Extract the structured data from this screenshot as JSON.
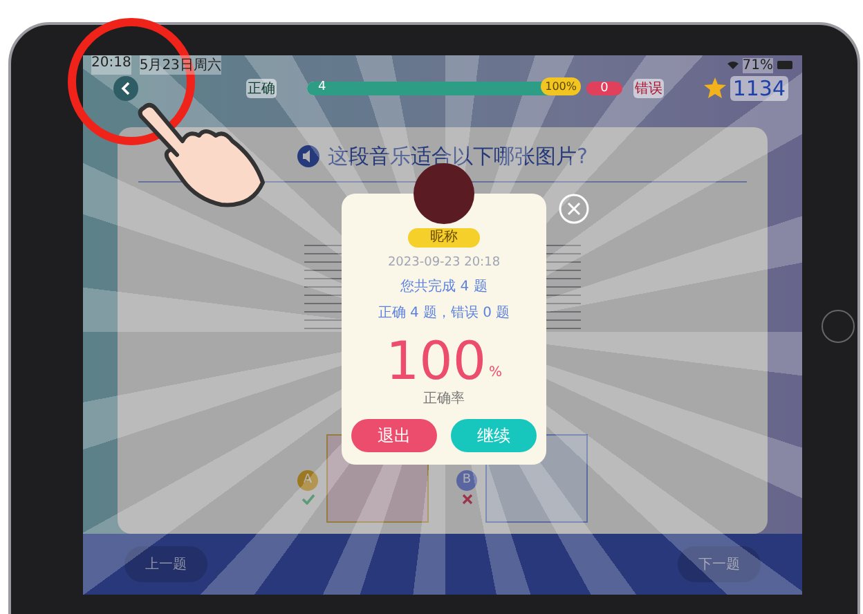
{
  "status_bar": {
    "time": "20:18",
    "date": "5月23日周六",
    "battery": "71%"
  },
  "top_bar": {
    "correct_label": "正确",
    "correct_count": "4",
    "progress": {
      "level": 1,
      "reading": "100%"
    },
    "wrong_count": "0",
    "wrong_label": "错误",
    "stars": "1134"
  },
  "question": {
    "text": "这段音乐适合以下哪张图片?"
  },
  "options": [
    {
      "label": "A",
      "correct": true
    },
    {
      "label": "B",
      "correct": false
    }
  ],
  "dialog": {
    "user_name": "昵称",
    "date": "2023-09-23 20:18",
    "completed": "您共完成 4 题",
    "summary": "正确 4 题，错误 0 题",
    "score": "100",
    "unit": "%",
    "score_label": "正确率",
    "buttons": [
      {
        "label": "退出",
        "kind": "exit"
      },
      {
        "label": "继续",
        "kind": "continue"
      }
    ]
  },
  "nav": {
    "prev": "上一题",
    "next": "下一题"
  }
}
